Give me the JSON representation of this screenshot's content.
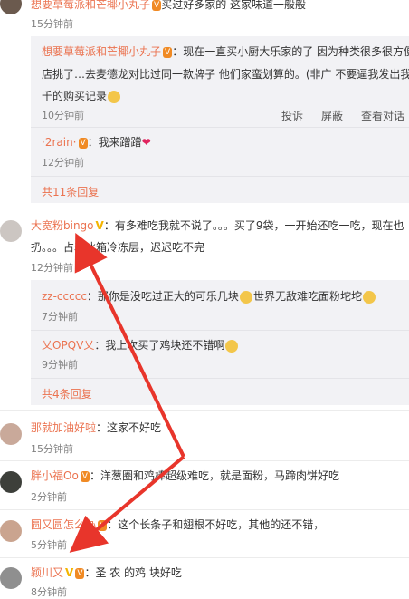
{
  "top_reply": {
    "user": "想要草莓派和芒椰小丸子",
    "text": "买过好多家的 这家味道一般般",
    "time": "15分钟前"
  },
  "thread1": {
    "reply1": {
      "user": "想要草莓派和芒椰小丸子",
      "text": "：现在一直买小厨大乐家的了 因为种类很多很方便",
      "text2": "店挑了…去麦德龙对比过同一款牌子 他们家蛮划算的。(非广 不要逼我发出我",
      "text3": "千的购买记录",
      "time": "10分钟前",
      "actions": {
        "report": "投诉",
        "block": "屏蔽",
        "view": "查看对话"
      }
    },
    "reply2": {
      "user": "·2rain·",
      "text": "：我来蹭蹭",
      "time": "12分钟前"
    },
    "more": "共11条回复"
  },
  "comment1": {
    "user": "大宽粉bingo",
    "text": "：有多难吃我就不说了。。。买了9袋，一开始还吃一吃，现在也",
    "text2": "扔。。。占着冰箱冷冻层，迟迟吃不完",
    "time": "12分钟前",
    "replies": [
      {
        "user": "zz-ccccc",
        "text": "：那你是没吃过正大的可乐几块",
        "text2": "世界无敌难吃面粉坨坨",
        "time": "7分钟前"
      },
      {
        "user": "乂OPQV乂",
        "text": "：我上次买了鸡块还不错啊",
        "time": "9分钟前"
      }
    ],
    "more": "共4条回复"
  },
  "comment2": {
    "user": "那就加油好啦",
    "text": "：这家不好吃",
    "time": "15分钟前"
  },
  "comment3": {
    "user": "胖小福Oo",
    "text": "：洋葱圈和鸡棒超级难吃，就是面粉，马蹄肉饼好吃",
    "time": "2分钟前"
  },
  "comment4": {
    "user": "圆又圆怎么办",
    "text": "：这个长条子和翅根不好吃，其他的还不错，",
    "time": "5分钟前"
  },
  "comment5": {
    "user": "颖川又",
    "text": "：圣 农 的鸡 块好吃",
    "time": "8分钟前"
  },
  "colors": {
    "username": "#eb7350",
    "arrow": "#e8352b",
    "reply_bg": "#f2f2f5"
  }
}
